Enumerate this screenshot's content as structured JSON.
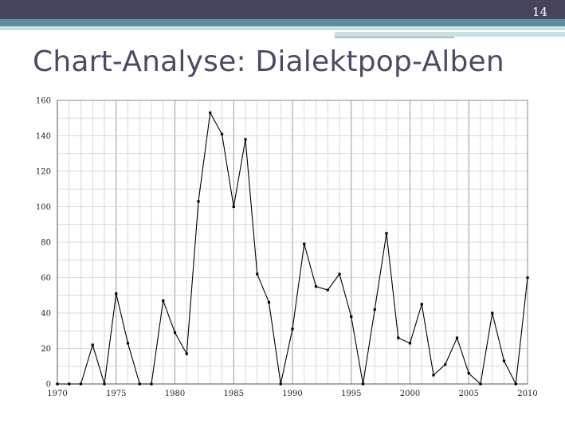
{
  "slide": {
    "number": "14",
    "title": "Chart-Analyse: Dialektpop-Alben"
  },
  "colors": {
    "header_band": "#45445a",
    "teal_stripe": "#5b8f97",
    "pale_stripe": "#c9dfe1",
    "title": "#4a4c64",
    "line": "#000000",
    "grid_minor": "#cfcfcf",
    "grid_major": "#9a9a9a"
  },
  "chart_data": {
    "type": "line",
    "title": "",
    "xlabel": "",
    "ylabel": "",
    "xlim": [
      1970,
      2010
    ],
    "ylim": [
      0,
      160
    ],
    "grid": true,
    "x_ticks": [
      1970,
      1975,
      1980,
      1985,
      1990,
      1995,
      2000,
      2005,
      2010
    ],
    "y_ticks": [
      0,
      20,
      40,
      60,
      80,
      100,
      120,
      140,
      160
    ],
    "x": [
      1970,
      1971,
      1972,
      1973,
      1974,
      1975,
      1976,
      1977,
      1978,
      1979,
      1980,
      1981,
      1982,
      1983,
      1984,
      1985,
      1986,
      1987,
      1988,
      1989,
      1990,
      1991,
      1992,
      1993,
      1994,
      1995,
      1996,
      1997,
      1998,
      1999,
      2000,
      2001,
      2002,
      2003,
      2004,
      2005,
      2006,
      2007,
      2008,
      2009,
      2010
    ],
    "series": [
      {
        "values": [
          0,
          0,
          0,
          22,
          0,
          51,
          23,
          0,
          0,
          47,
          29,
          17,
          103,
          153,
          141,
          100,
          138,
          62,
          46,
          0,
          31,
          79,
          55,
          53,
          62,
          38,
          0,
          42,
          85,
          26,
          23,
          45,
          5,
          11,
          26,
          6,
          0,
          40,
          13,
          0,
          60
        ]
      }
    ]
  }
}
